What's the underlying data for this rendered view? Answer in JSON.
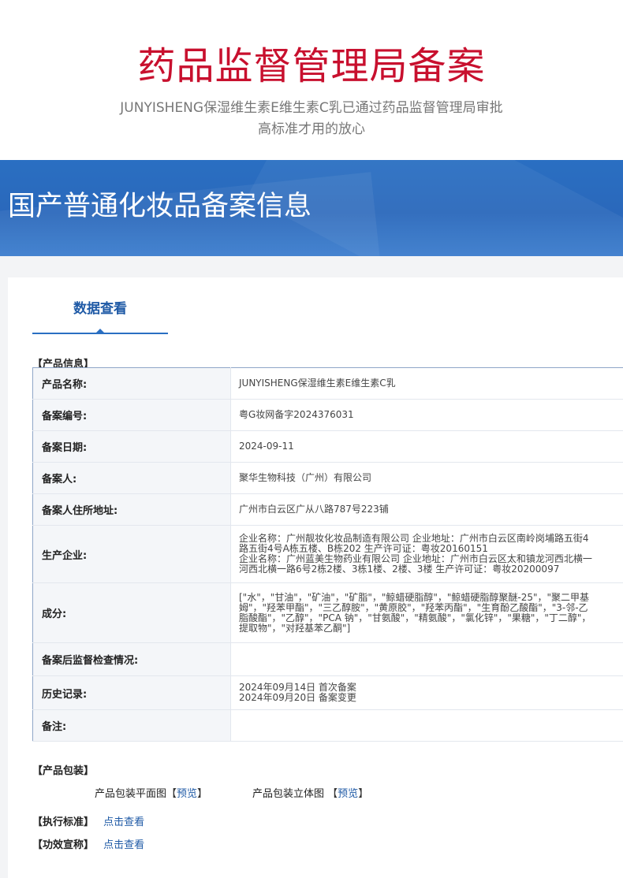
{
  "header": {
    "title": "药品监督管理局备案",
    "subtitle_line1": "JUNYISHENG保湿维生素E维生素C乳已通过药品监督管理局审批",
    "subtitle_line2": "高标准才用的放心"
  },
  "banner": {
    "title": "国产普通化妆品备案信息"
  },
  "tabs": {
    "active": "数据查看"
  },
  "product_info": {
    "section_title": "【产品信息】",
    "rows": [
      {
        "key": "产品名称:",
        "value": "JUNYISHENG保湿维生素E维生素C乳"
      },
      {
        "key": "备案编号:",
        "value": "粤G妆网备字2024376031"
      },
      {
        "key": "备案日期:",
        "value": "2024-09-11"
      },
      {
        "key": "备案人:",
        "value": "聚华生物科技（广州）有限公司"
      },
      {
        "key": "备案人住所地址:",
        "value": "广州市白云区广从八路787号223铺"
      },
      {
        "key": "生产企业:",
        "value": "企业名称：广州靓妆化妆品制造有限公司 企业地址：广州市白云区南岭岗埔路五街4路五街4号A栋五楼、B栋202 生产许可证：粤妆20160151 企业名称：广州蓝美生物药业有限公司 企业地址：广州市白云区太和镇龙河西北横一河西北横一路6号2栋2楼、3栋1楼、2楼、3楼 生产许可证：粤妆20200097"
      },
      {
        "key": "成分:",
        "value": "[\"水\"，\"甘油\"，\"矿油\"，\"矿脂\"，\"鲸蜡硬脂醇\"，\"鲸蜡硬脂醇聚醚-25\"，\"聚二甲基姆\"，\"羟苯甲酯\"，\"三乙醇胺\"，\"黄原胶\"，\"羟苯丙酯\"，\"生育酚乙酸酯\"，\"3-邻-乙脂酸酯\"，\"乙醇\"，\"PCA 钠\"，\"甘氨酸\"，\"精氨酸\"，\"氯化锌\"，\"果糖\"，\"丁二醇\"，提取物\"，\"对羟基苯乙酮\"]"
      },
      {
        "key": "备案后监督检查情况:",
        "value": ""
      },
      {
        "key": "历史记录:",
        "value": "2024年09月14日 首次备案 2024年09月20日 备案变更"
      },
      {
        "key": "备注:",
        "value": ""
      }
    ]
  },
  "production_company_lines": [
    "企业名称：广州靓妆化妆品制造有限公司 企业地址：广州市白云区南岭岗埔路五街4",
    "路五街4号A栋五楼、B栋202 生产许可证：粤妆20160151",
    "企业名称：广州蓝美生物药业有限公司 企业地址：广州市白云区太和镇龙河西北横一",
    "河西北横一路6号2栋2楼、3栋1楼、2楼、3楼 生产许可证：粤妆20200097"
  ],
  "ingredient_lines": [
    "[\"水\"，\"甘油\"，\"矿油\"，\"矿脂\"，\"鲸蜡硬脂醇\"，\"鲸蜡硬脂醇聚醚-25\"，\"聚二甲基",
    "姆\"，\"羟苯甲酯\"，\"三乙醇胺\"，\"黄原胶\"，\"羟苯丙酯\"，\"生育酚乙酸酯\"，\"3-邻-乙",
    "脂酸酯\"，\"乙醇\"，\"PCA 钠\"，\"甘氨酸\"，\"精氨酸\"，\"氯化锌\"，\"果糖\"，\"丁二醇\"，",
    "提取物\"，\"对羟基苯乙酮\"]"
  ],
  "history_lines": [
    "2024年09月14日 首次备案",
    "2024年09月20日 备案变更"
  ],
  "packaging": {
    "section_title": "【产品包装】",
    "flat_label": "产品包装平面图",
    "flat_link": "预览",
    "solid_label": "产品包装立体图",
    "solid_link": "预览",
    "bracket_open": "【",
    "bracket_close": "】"
  },
  "standard": {
    "label": "【执行标准】",
    "link": "点击查看"
  },
  "efficacy": {
    "label": "【功效宣称】",
    "link": "点击查看"
  }
}
